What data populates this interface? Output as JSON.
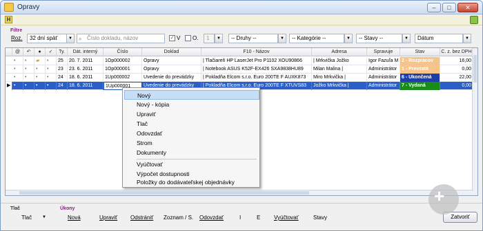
{
  "window": {
    "title": "Opravy"
  },
  "menubar": {
    "h_label": "H"
  },
  "filters": {
    "section_label": "Filtre",
    "roz_label": "Roz.",
    "period": "32 dní späť",
    "search_placeholder": "Číslo dokladu, názov",
    "v_label": "V",
    "o_label": "O.",
    "o_value": "1",
    "druhy": "-- Druhy --",
    "kategorie": "-- Kategórie --",
    "stavy": "-- Stavy --",
    "datum": "Dátum"
  },
  "table": {
    "columns": [
      "Ty.",
      "Dát. interný",
      "Číslo",
      "Doklad",
      "F10 - Názov",
      "Adresa",
      "Spravuje",
      "Stav",
      "C. z. bez DPH"
    ],
    "rows": [
      {
        "ty": "25",
        "date": "20. 7. 2011",
        "cislo": "1Op000002",
        "doklad": "Opravy",
        "nazov": "| Tlačiareň HP LaserJet Pro P1102 XOU90866",
        "adresa": "| Mrkvička Jožko",
        "spravuje": "Igor Fazuľa M",
        "stav": "2 - Rozpracov",
        "stav_color": "#f4c48e",
        "cena": "16,00"
      },
      {
        "ty": "23",
        "date": "23. 6. 2011",
        "cislo": "1Op000001",
        "doklad": "Opravy",
        "nazov": "| Notebook ASUS K52F-EX426 SXA9838HU89",
        "adresa": "Milan Malina |",
        "spravuje": "Administrátor",
        "stav": "1 - Prevzatá",
        "stav_color": "#f9c48a",
        "cena": "0,00"
      },
      {
        "ty": "24",
        "date": "18. 6. 2011",
        "cislo": "1Up000002",
        "doklad": "Uvedenie do prevádzky",
        "nazov": "| Pokladňa Elcom s.r.o. Euro 200TE F AUXK873",
        "adresa": "Miro Mrkvička |",
        "spravuje": "Administrátor",
        "stav": "6 - Ukončená",
        "stav_color": "#1d3ea8",
        "cena": "22,00"
      },
      {
        "ty": "24",
        "date": "18. 6. 2011",
        "cislo": "1Up000001",
        "doklad": "Uvedenie do prevádzky",
        "nazov": "| Pokladňa Elcom s.r.o. Euro 200TE F XTUVS83",
        "adresa": "Jožko Mrkvička |",
        "spravuje": "Administrátor",
        "stav": "7 - Vydaná",
        "stav_color": "#1a8a1a",
        "cena": "0,00"
      }
    ]
  },
  "context_menu": {
    "items": [
      "Nový",
      "Nový - kópia",
      "Upraviť",
      "Tlač",
      "Odovzdať",
      "Strom",
      "Dokumenty"
    ],
    "items2": [
      "Vyúčtovať",
      "Výpočet dostupnosti",
      "Položky do dodávateľskej objednávky"
    ]
  },
  "bottom": {
    "tlac_label": "Tlač",
    "ukony_label": "Úkony",
    "tlac_button": "Tlač",
    "buttons": [
      "Nová",
      "Upraviť",
      "Odstrániť",
      "Zoznam / S.",
      "Odovzdať",
      "I",
      "E",
      "Vyúčtovať",
      "Stavy"
    ],
    "close": "Zatvoriť"
  }
}
